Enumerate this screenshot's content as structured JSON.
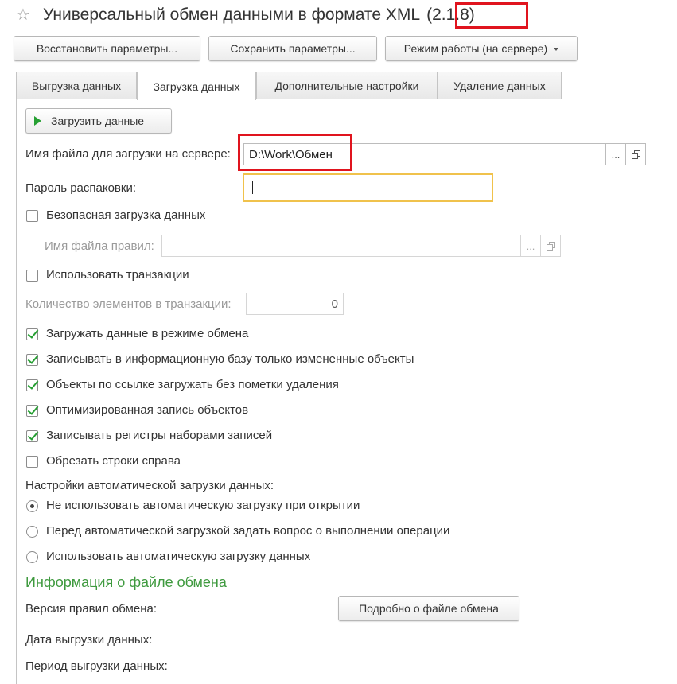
{
  "window": {
    "title": "Универсальный обмен данными в формате XML",
    "version": "(2.1.8)"
  },
  "colors": {
    "accent_green": "#27a033",
    "heading_green": "#3f9a3f",
    "highlight_red": "#e0141e",
    "focus_yellow": "#f0c24c"
  },
  "toolbar": {
    "restore_label": "Восстановить параметры...",
    "save_label": "Сохранить параметры...",
    "mode_label": "Режим работы (на сервере)"
  },
  "tabs": [
    {
      "label": "Выгрузка данных",
      "active": false
    },
    {
      "label": "Загрузка данных",
      "active": true
    },
    {
      "label": "Дополнительные настройки",
      "active": false
    },
    {
      "label": "Удаление данных",
      "active": false
    }
  ],
  "load": {
    "button_label": "Загрузить данные",
    "file_label": "Имя файла для загрузки на сервере:",
    "file_value": "D:\\Work\\Обмен",
    "password_label": "Пароль распаковки:",
    "password_value": "",
    "safe_load_label": "Безопасная загрузка данных",
    "safe_load_checked": false,
    "rules_file_label": "Имя файла правил:",
    "rules_file_value": "",
    "use_transactions_label": "Использовать транзакции",
    "use_transactions_checked": false,
    "transaction_count_label": "Количество элементов в транзакции:",
    "transaction_count_value": "0",
    "choose_button": "...",
    "options": [
      {
        "label": "Загружать данные в режиме обмена",
        "checked": true
      },
      {
        "label": "Записывать в информационную базу только измененные объекты",
        "checked": true
      },
      {
        "label": "Объекты по ссылке загружать без пометки удаления",
        "checked": true
      },
      {
        "label": "Оптимизированная запись объектов",
        "checked": true
      },
      {
        "label": "Записывать регистры наборами записей",
        "checked": true
      },
      {
        "label": "Обрезать строки справа",
        "checked": false
      }
    ]
  },
  "auto_load": {
    "heading": "Настройки автоматической загрузки данных:",
    "options": [
      {
        "label": "Не использовать автоматическую загрузку при открытии",
        "selected": true
      },
      {
        "label": "Перед автоматической загрузкой задать вопрос о выполнении операции",
        "selected": false
      },
      {
        "label": "Использовать автоматическую загрузку данных",
        "selected": false
      }
    ]
  },
  "exchange_info": {
    "heading": "Информация о файле обмена",
    "rules_version_label": "Версия правил обмена:",
    "details_button": "Подробно о файле обмена",
    "export_date_label": "Дата выгрузки данных:",
    "export_period_label": "Период выгрузки данных:"
  }
}
